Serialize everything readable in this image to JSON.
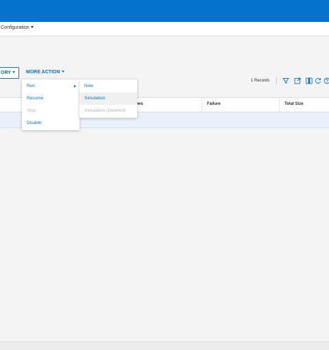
{
  "nav": {
    "configuration_label": "Configuration"
  },
  "toolbar": {
    "history_label": "ORY",
    "more_action_label": "MORE ACTION",
    "records_label": "1 Records"
  },
  "table": {
    "headers": [
      "Failure",
      "Total Size"
    ],
    "partial_header": "ows"
  },
  "more_action_menu": {
    "items": [
      {
        "label": "Run",
        "disabled": false
      },
      {
        "label": "Resume",
        "disabled": false
      },
      {
        "label": "Stop",
        "disabled": true
      },
      {
        "label": "Disable",
        "disabled": false
      }
    ]
  },
  "run_submenu": {
    "items": [
      {
        "label": "Now",
        "disabled": false
      },
      {
        "label": "Simulation",
        "disabled": false
      },
      {
        "label": "Simulation (Detailed)",
        "disabled": true
      }
    ]
  },
  "icons": [
    "filter-icon",
    "export-icon",
    "columns-icon",
    "refresh-icon",
    "help-icon"
  ],
  "colors": {
    "brand": "#0572ce",
    "selected_row": "#e8f1fa",
    "disabled_text": "#b4b4b4"
  }
}
